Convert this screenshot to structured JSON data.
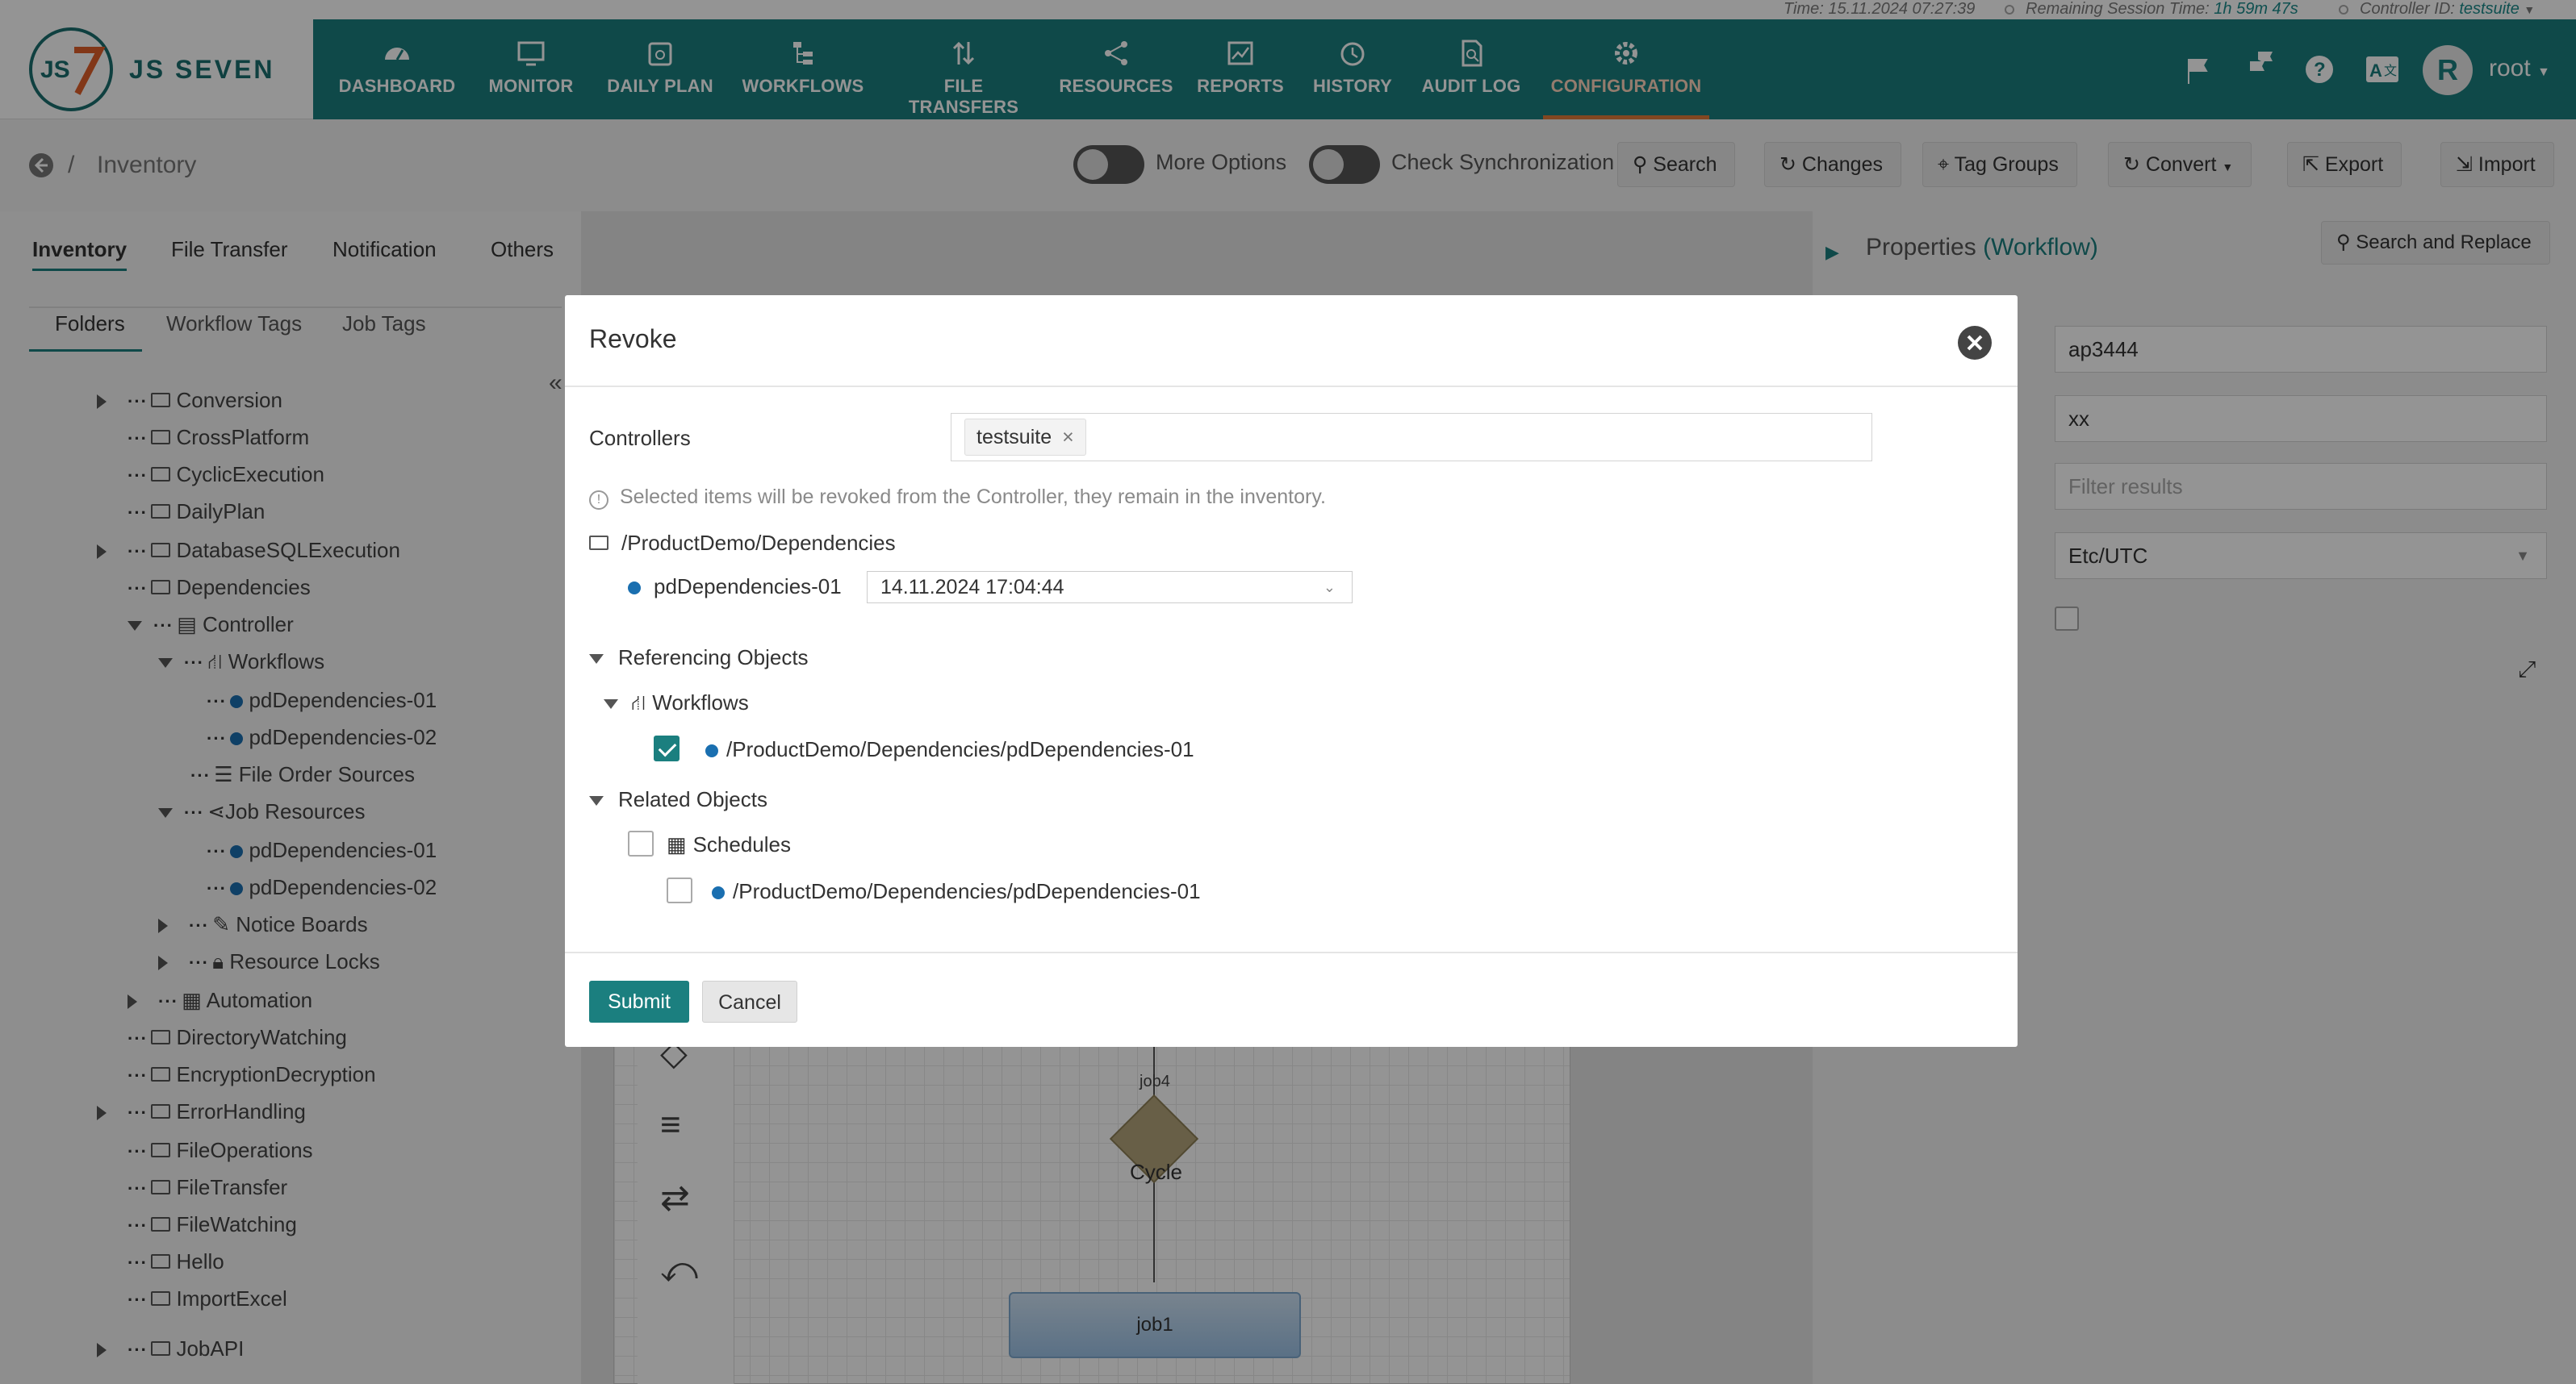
{
  "status_bar": {
    "time_label": "Time:",
    "time_value": "15.11.2024 07:27:39",
    "session_label": "Remaining Session Time:",
    "session_value": "1h 59m 47s",
    "controller_label": "Controller ID:",
    "controller_value": "testsuite"
  },
  "brand": {
    "logo_text": "JS SEVEN"
  },
  "nav": {
    "items": [
      {
        "label": "DASHBOARD",
        "icon": "dashboard-icon"
      },
      {
        "label": "MONITOR",
        "icon": "monitor-icon"
      },
      {
        "label": "DAILY PLAN",
        "icon": "calendar-icon"
      },
      {
        "label": "WORKFLOWS",
        "icon": "workflow-icon"
      },
      {
        "label": "FILE TRANSFERS",
        "icon": "transfer-icon"
      },
      {
        "label": "RESOURCES",
        "icon": "share-icon"
      },
      {
        "label": "REPORTS",
        "icon": "chart-icon"
      },
      {
        "label": "HISTORY",
        "icon": "clock-icon"
      },
      {
        "label": "AUDIT LOG",
        "icon": "audit-icon"
      },
      {
        "label": "CONFIGURATION",
        "icon": "gear-icon"
      }
    ],
    "active": "CONFIGURATION",
    "user": "root",
    "avatar_letter": "R"
  },
  "subheader": {
    "breadcrumb_sep": "/",
    "breadcrumb": "Inventory",
    "toggle_more_options": "More Options",
    "toggle_check_sync": "Check Synchronization",
    "search": "Search",
    "changes": "Changes",
    "tag_groups": "Tag Groups",
    "convert": "Convert",
    "export": "Export",
    "import": "Import"
  },
  "left": {
    "tabs": [
      "Inventory",
      "File Transfer",
      "Notification",
      "Others"
    ],
    "subtabs": [
      "Folders",
      "Workflow Tags",
      "Job Tags"
    ],
    "tree": [
      {
        "label": "Conversion"
      },
      {
        "label": "CrossPlatform"
      },
      {
        "label": "CyclicExecution"
      },
      {
        "label": "DailyPlan"
      },
      {
        "label": "DatabaseSQLExecution"
      },
      {
        "label": "Dependencies"
      },
      {
        "label": "Controller"
      },
      {
        "label": "Workflows"
      },
      {
        "label": "pdDependencies-01"
      },
      {
        "label": "pdDependencies-02"
      },
      {
        "label": "File Order Sources"
      },
      {
        "label": "Job Resources"
      },
      {
        "label": "pdDependencies-01"
      },
      {
        "label": "pdDependencies-02"
      },
      {
        "label": "Notice Boards"
      },
      {
        "label": "Resource Locks"
      },
      {
        "label": "Automation"
      },
      {
        "label": "DirectoryWatching"
      },
      {
        "label": "EncryptionDecryption"
      },
      {
        "label": "ErrorHandling"
      },
      {
        "label": "FileOperations"
      },
      {
        "label": "FileTransfer"
      },
      {
        "label": "FileWatching"
      },
      {
        "label": "Hello"
      },
      {
        "label": "ImportExcel"
      },
      {
        "label": "JobAPI"
      }
    ]
  },
  "right": {
    "title": "Properties",
    "title_type": "(Workflow)",
    "search_replace": "Search and Replace",
    "field_name": "ap3444",
    "field_title": "xx",
    "filter_placeholder": "Filter results",
    "timezone": "Etc/UTC"
  },
  "canvas": {
    "job4_label": "job4",
    "cycle_label": "Cycle",
    "job1_label": "job1"
  },
  "modal": {
    "title": "Revoke",
    "controllers_label": "Controllers",
    "controller_tag": "testsuite",
    "info": "Selected items will be revoked from the Controller, they remain in the inventory.",
    "folder_path": "/ProductDemo/Dependencies",
    "item_name": "pdDependencies-01",
    "item_version": "14.11.2024 17:04:44",
    "referencing_header": "Referencing Objects",
    "workflows_label": "Workflows",
    "ref_workflow_path": "/ProductDemo/Dependencies/pdDependencies-01",
    "related_header": "Related Objects",
    "schedules_label": "Schedules",
    "schedule_path": "/ProductDemo/Dependencies/pdDependencies-01",
    "submit": "Submit",
    "cancel": "Cancel"
  }
}
